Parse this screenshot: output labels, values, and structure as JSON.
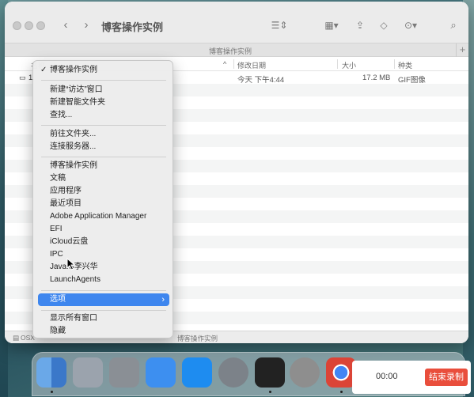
{
  "window": {
    "title": "博客操作实例",
    "tab_title": "博客操作实例",
    "tab_plus": "+"
  },
  "columns": {
    "name": "名称",
    "date": "修改日期",
    "size": "大小",
    "kind": "种类",
    "sort_indicator": "^"
  },
  "file": {
    "name_visible": "1.",
    "date": "今天 下午4:44",
    "size": "17.2 MB",
    "kind": "GIF图像"
  },
  "status": {
    "path_start": "OSX",
    "path_end": "博客操作实例"
  },
  "menu": {
    "current_folder": "博客操作实例",
    "items_a": [
      "新建“访达”窗口",
      "新建智能文件夹",
      "查找..."
    ],
    "items_b": [
      "前往文件夹...",
      "连接服务器..."
    ],
    "items_c": [
      "博客操作实例",
      "文稿",
      "应用程序",
      "最近项目",
      "Adobe Application Manager",
      "EFI",
      "iCloud云盘",
      "IPC",
      "JavaIS李兴华",
      "LaunchAgents"
    ],
    "options": "选项",
    "items_d": [
      "显示所有窗口",
      "隐藏"
    ]
  },
  "recorder": {
    "time": "00:00",
    "stop_label": "结束录制"
  },
  "colors": {
    "highlight": "#3e86ee",
    "record_button": "#e94e3c"
  },
  "dock_icons": [
    "finder-icon",
    "launchpad-icon",
    "screenshot-icon",
    "mail-icon",
    "app-store-icon",
    "system-preferences-icon",
    "terminal-icon",
    "gear-utility-icon",
    "chrome-icon"
  ]
}
